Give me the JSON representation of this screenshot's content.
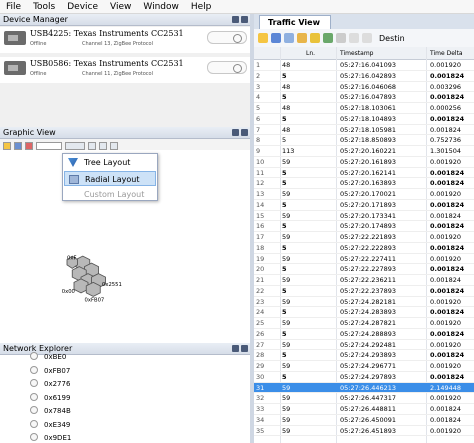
{
  "menu": [
    "File",
    "Tools",
    "Device",
    "View",
    "Window",
    "Help"
  ],
  "device_manager": {
    "title": "Device Manager",
    "devices": [
      {
        "name": "USB4225: Texas Instruments CC2531",
        "status": "Offline",
        "channel": "Channel 13, ZigBee Protocol"
      },
      {
        "name": "USB0586: Texas Instruments CC2531",
        "status": "Offline",
        "channel": "Channel 11, ZigBee Protocol"
      }
    ]
  },
  "graphic_view": {
    "title": "Graphic View",
    "layout_menu": {
      "items": [
        {
          "label": "Tree Layout",
          "state": "normal"
        },
        {
          "label": "Radial Layout",
          "state": "selected"
        },
        {
          "label": "Custom Layout",
          "state": "disabled"
        }
      ]
    },
    "node_labels": [
      "0xF",
      "0x00",
      "0x2551",
      "0xFB07"
    ]
  },
  "network_explorer": {
    "title": "Network Explorer",
    "items": [
      "0xBE0",
      "0xFB07",
      "0x2776",
      "0x6199",
      "0x784B",
      "0xE349",
      "0x9DE1"
    ]
  },
  "traffic_view": {
    "tab_label": "Traffic View",
    "toolbar_text": "Destin",
    "columns": [
      "Ln.",
      "Timestamp",
      "Time Delta"
    ],
    "rows": [
      {
        "id": "1",
        "len": "48",
        "ts": "05:27:16.041093",
        "delta": "0.001920",
        "bold": false,
        "highlight": false
      },
      {
        "id": "2",
        "len": "5",
        "ts": "05:27:16.042893",
        "delta": "0.001824",
        "bold": true,
        "highlight": false
      },
      {
        "id": "3",
        "len": "48",
        "ts": "05:27:16.046068",
        "delta": "0.003296",
        "bold": false,
        "highlight": false
      },
      {
        "id": "4",
        "len": "5",
        "ts": "05:27:16.047893",
        "delta": "0.001824",
        "bold": true,
        "highlight": false
      },
      {
        "id": "5",
        "len": "48",
        "ts": "05:27:18.103061",
        "delta": "0.000256",
        "bold": false,
        "highlight": false
      },
      {
        "id": "6",
        "len": "5",
        "ts": "05:27:18.104893",
        "delta": "0.001824",
        "bold": true,
        "highlight": false
      },
      {
        "id": "7",
        "len": "48",
        "ts": "05:27:18.105981",
        "delta": "0.001824",
        "bold": false,
        "highlight": false
      },
      {
        "id": "8",
        "len": "5",
        "ts": "05:27:18.850893",
        "delta": "0.752736",
        "bold": false,
        "highlight": false
      },
      {
        "id": "9",
        "len": "113",
        "ts": "05:27:20.160221",
        "delta": "1.301504",
        "bold": false,
        "highlight": false
      },
      {
        "id": "10",
        "len": "59",
        "ts": "05:27:20.161893",
        "delta": "0.001920",
        "bold": false,
        "highlight": false
      },
      {
        "id": "11",
        "len": "5",
        "ts": "05:27:20.162141",
        "delta": "0.001824",
        "bold": true,
        "highlight": false
      },
      {
        "id": "12",
        "len": "5",
        "ts": "05:27:20.163893",
        "delta": "0.001824",
        "bold": true,
        "highlight": false
      },
      {
        "id": "13",
        "len": "59",
        "ts": "05:27:20.170021",
        "delta": "0.001920",
        "bold": false,
        "highlight": false
      },
      {
        "id": "14",
        "len": "5",
        "ts": "05:27:20.171893",
        "delta": "0.001824",
        "bold": true,
        "highlight": false
      },
      {
        "id": "15",
        "len": "59",
        "ts": "05:27:20.173341",
        "delta": "0.001824",
        "bold": false,
        "highlight": false
      },
      {
        "id": "16",
        "len": "5",
        "ts": "05:27:20.174893",
        "delta": "0.001824",
        "bold": true,
        "highlight": false
      },
      {
        "id": "17",
        "len": "59",
        "ts": "05:27:22.221893",
        "delta": "0.001920",
        "bold": false,
        "highlight": false
      },
      {
        "id": "18",
        "len": "5",
        "ts": "05:27:22.222893",
        "delta": "0.001824",
        "bold": true,
        "highlight": false
      },
      {
        "id": "19",
        "len": "59",
        "ts": "05:27:22.227411",
        "delta": "0.001920",
        "bold": false,
        "highlight": false
      },
      {
        "id": "20",
        "len": "5",
        "ts": "05:27:22.227893",
        "delta": "0.001824",
        "bold": true,
        "highlight": false
      },
      {
        "id": "21",
        "len": "59",
        "ts": "05:27:22.236211",
        "delta": "0.001824",
        "bold": false,
        "highlight": false
      },
      {
        "id": "22",
        "len": "5",
        "ts": "05:27:22.237893",
        "delta": "0.001824",
        "bold": true,
        "highlight": false
      },
      {
        "id": "23",
        "len": "59",
        "ts": "05:27:24.282181",
        "delta": "0.001920",
        "bold": false,
        "highlight": false
      },
      {
        "id": "24",
        "len": "5",
        "ts": "05:27:24.283893",
        "delta": "0.001824",
        "bold": true,
        "highlight": false
      },
      {
        "id": "25",
        "len": "59",
        "ts": "05:27:24.287821",
        "delta": "0.001920",
        "bold": false,
        "highlight": false
      },
      {
        "id": "26",
        "len": "5",
        "ts": "05:27:24.288893",
        "delta": "0.001824",
        "bold": true,
        "highlight": false
      },
      {
        "id": "27",
        "len": "59",
        "ts": "05:27:24.292481",
        "delta": "0.001920",
        "bold": false,
        "highlight": false
      },
      {
        "id": "28",
        "len": "5",
        "ts": "05:27:24.293893",
        "delta": "0.001824",
        "bold": true,
        "highlight": false
      },
      {
        "id": "29",
        "len": "59",
        "ts": "05:27:24.296771",
        "delta": "0.001920",
        "bold": false,
        "highlight": false
      },
      {
        "id": "30",
        "len": "5",
        "ts": "05:27:24.297893",
        "delta": "0.001824",
        "bold": true,
        "highlight": false
      },
      {
        "id": "31",
        "len": "59",
        "ts": "05:27:26.446213",
        "delta": "2.149448",
        "bold": false,
        "highlight": true
      },
      {
        "id": "32",
        "len": "59",
        "ts": "05:27:26.447317",
        "delta": "0.001920",
        "bold": false,
        "highlight": false
      },
      {
        "id": "33",
        "len": "59",
        "ts": "05:27:26.448811",
        "delta": "0.001824",
        "bold": false,
        "highlight": false
      },
      {
        "id": "34",
        "len": "59",
        "ts": "05:27:26.450091",
        "delta": "0.001824",
        "bold": false,
        "highlight": false
      },
      {
        "id": "35",
        "len": "59",
        "ts": "05:27:26.451893",
        "delta": "0.001920",
        "bold": false,
        "highlight": false
      }
    ]
  },
  "colors": {
    "accent": "#3b8ee8",
    "menu_selected": "#cde2f7",
    "panel_header": "#d6dde8"
  }
}
